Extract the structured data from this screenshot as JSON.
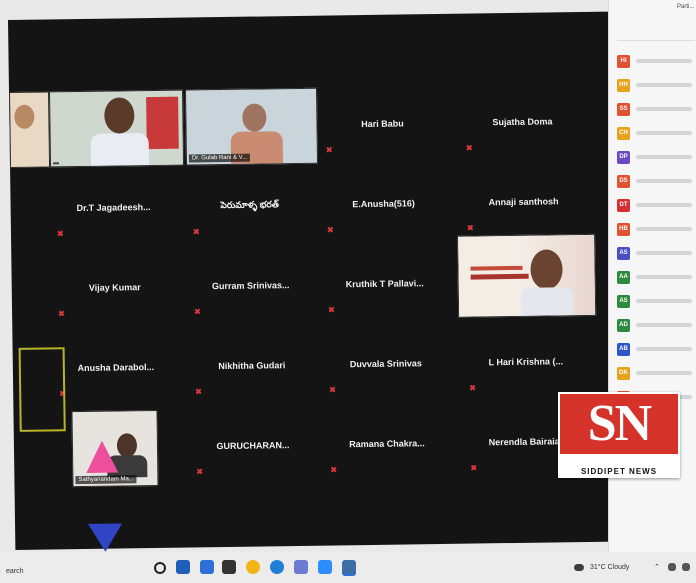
{
  "meeting": {
    "tiles": [
      {
        "name": "Hari Babu"
      },
      {
        "name": "Sujatha Doma"
      },
      {
        "name": "Dr.T Jagadeesh..."
      },
      {
        "name": "పెరుమాళ్ళ భరత్"
      },
      {
        "name": "E.Anusha(516)"
      },
      {
        "name": "Annaji santhosh"
      },
      {
        "name": "Vijay Kumar"
      },
      {
        "name": "Gurram Srinivas..."
      },
      {
        "name": "Kruthik T Pallavi..."
      },
      {
        "name": "Anusha Darabol..."
      },
      {
        "name": "Nikhitha Gudari"
      },
      {
        "name": "Duvvala Srinivas"
      },
      {
        "name": "L Hari Krishna (..."
      },
      {
        "name": "GURUCHARAN..."
      },
      {
        "name": "Ramana Chakra..."
      },
      {
        "name": "Nerendla Bairaiah"
      }
    ],
    "video_tiles": [
      {
        "tag": ""
      },
      {
        "tag": "Dr. Gulab Rani & V..."
      },
      {
        "tag": "Sathyanandam Ma..."
      }
    ]
  },
  "panel": {
    "title": "Parti...",
    "participants": [
      {
        "initials": "HI",
        "color": "#e0532e"
      },
      {
        "initials": "HH",
        "color": "#e6a21b"
      },
      {
        "initials": "SS",
        "color": "#e0532e"
      },
      {
        "initials": "CH",
        "color": "#e6a21b"
      },
      {
        "initials": "DP",
        "color": "#6b48c4"
      },
      {
        "initials": "DS",
        "color": "#e0532e"
      },
      {
        "initials": "DT",
        "color": "#d62f2f"
      },
      {
        "initials": "HB",
        "color": "#e0532e"
      },
      {
        "initials": "AS",
        "color": "#4a4fc1"
      },
      {
        "initials": "AA",
        "color": "#2d8a3e"
      },
      {
        "initials": "AS",
        "color": "#2d8a3e"
      },
      {
        "initials": "AD",
        "color": "#2d8a3e"
      },
      {
        "initials": "AB",
        "color": "#2b57c9"
      },
      {
        "initials": "DK",
        "color": "#e6a21b"
      },
      {
        "initials": "DI",
        "color": "#e0532e"
      }
    ]
  },
  "logo": {
    "letters": "SN",
    "subtitle": "SIDDIPET NEWS"
  },
  "taskbar": {
    "search": "earch",
    "weather": "31°C Cloudy",
    "colors": {
      "edge": "#1f7fd6",
      "chrome": "#f2b416",
      "store": "#2d6fd6",
      "explorer": "#f2c84b"
    }
  }
}
